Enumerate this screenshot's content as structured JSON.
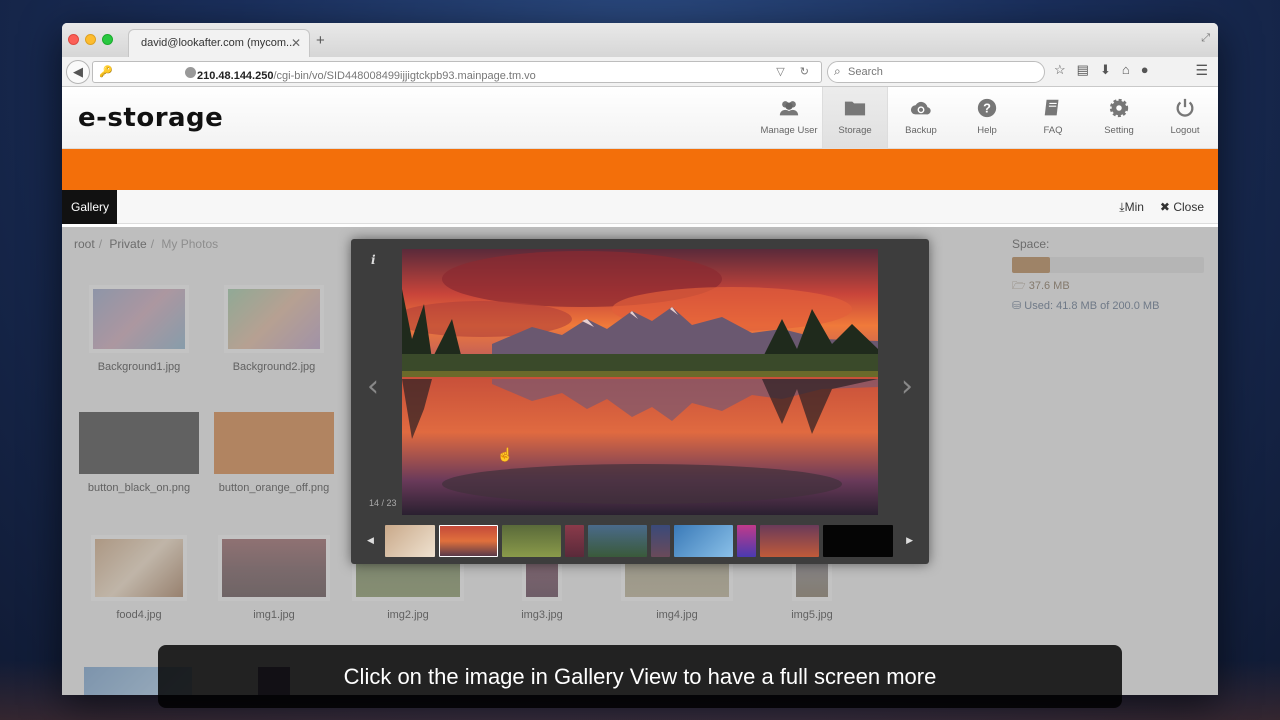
{
  "browser": {
    "tab_title": "david@lookafter.com (mycom...",
    "url_host": "210.48.144.250",
    "url_path": "/cgi-bin/vo/SID448008499ijjigtckpb93.mainpage.tm.vo",
    "search_placeholder": "Search"
  },
  "app": {
    "logo": "e-storage",
    "nav": [
      {
        "label": "Manage User",
        "icon": "users-icon"
      },
      {
        "label": "Storage",
        "icon": "folder-icon"
      },
      {
        "label": "Backup",
        "icon": "cloud-sync-icon"
      },
      {
        "label": "Help",
        "icon": "help-icon"
      },
      {
        "label": "FAQ",
        "icon": "book-icon"
      },
      {
        "label": "Setting",
        "icon": "gear-icon"
      },
      {
        "label": "Logout",
        "icon": "power-icon"
      }
    ],
    "active_nav": "Storage",
    "accent_color": "#f36f0a"
  },
  "gallery_bar": {
    "title": "Gallery",
    "min_label": "Min",
    "close_label": "Close"
  },
  "breadcrumb": [
    "root",
    "Private",
    "My Photos"
  ],
  "files": [
    {
      "name": "Background1.jpg"
    },
    {
      "name": "Background2.jpg"
    },
    {
      "name": "button_black_on.png"
    },
    {
      "name": "button_orange_off.png"
    },
    {
      "name": "food4.jpg"
    },
    {
      "name": "img1.jpg"
    },
    {
      "name": "img2.jpg"
    },
    {
      "name": "img3.jpg"
    },
    {
      "name": "img4.jpg"
    },
    {
      "name": "img5.jpg"
    }
  ],
  "space": {
    "label": "Space:",
    "used_folder": "37.6 MB",
    "used_total": "Used: 41.8 MB of 200.0 MB",
    "used_fraction": 0.2
  },
  "lightbox": {
    "info_label": "i",
    "counter": "14 / 23"
  },
  "caption": "Click on the image in Gallery View to have a full screen more"
}
